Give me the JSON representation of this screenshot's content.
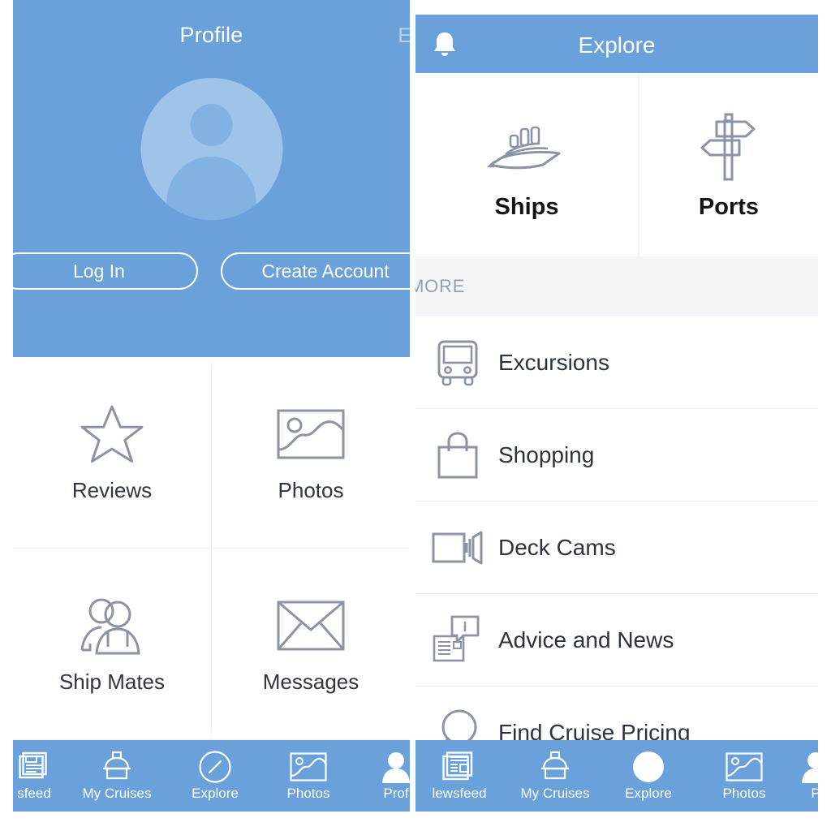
{
  "colors": {
    "brand_blue": "#6aa1db",
    "avatar_circle": "#9ec4e9",
    "avatar_silhouette": "#81b2e2",
    "icon_outline": "#8a94a6",
    "text_dark": "#2c3340",
    "section_bg": "#f3f5f8",
    "section_text": "#93a0ad",
    "edit_link": "#b9d4ee"
  },
  "profile_screen": {
    "header": {
      "title": "Profile",
      "edit_label": "Ed",
      "left_glyph": "▌"
    },
    "avatar_icon": "person-avatar-icon",
    "buttons": {
      "login_label": "Log In",
      "create_account_label": "Create Account"
    },
    "grid": [
      {
        "label": "Reviews",
        "icon": "star-icon"
      },
      {
        "label": "Photos",
        "icon": "photo-icon"
      },
      {
        "label": "Ship Mates",
        "icon": "people-icon"
      },
      {
        "label": "Messages",
        "icon": "envelope-icon"
      }
    ],
    "tabs": [
      {
        "label": "sfeed",
        "icon": "newsfeed-icon",
        "active": false
      },
      {
        "label": "My Cruises",
        "icon": "ship-icon",
        "active": false
      },
      {
        "label": "Explore",
        "icon": "compass-icon",
        "active": false
      },
      {
        "label": "Photos",
        "icon": "photo-icon",
        "active": false
      },
      {
        "label": "Prof",
        "icon": "profile-icon",
        "active": true
      }
    ]
  },
  "explore_screen": {
    "header": {
      "title": "Explore",
      "bell_icon": "bell-icon"
    },
    "tiles": [
      {
        "label": "Ships",
        "icon": "cruise-ship-icon"
      },
      {
        "label": "Ports",
        "icon": "signpost-icon"
      }
    ],
    "section_label": "MORE",
    "list": [
      {
        "label": "Excursions",
        "icon": "bus-icon"
      },
      {
        "label": "Shopping",
        "icon": "shopping-bag-icon"
      },
      {
        "label": "Deck Cams",
        "icon": "video-camera-icon"
      },
      {
        "label": "Advice and News",
        "icon": "newspaper-info-icon"
      },
      {
        "label": "Find Cruise Pricing",
        "icon": "magnifier-icon"
      }
    ],
    "tabs": [
      {
        "label": "lewsfeed",
        "icon": "newsfeed-icon",
        "active": false
      },
      {
        "label": "My Cruises",
        "icon": "ship-icon",
        "active": false
      },
      {
        "label": "Explore",
        "icon": "compass-icon",
        "active": true
      },
      {
        "label": "Photos",
        "icon": "photo-icon",
        "active": false
      },
      {
        "label": "P",
        "icon": "profile-icon",
        "active": false
      }
    ]
  }
}
